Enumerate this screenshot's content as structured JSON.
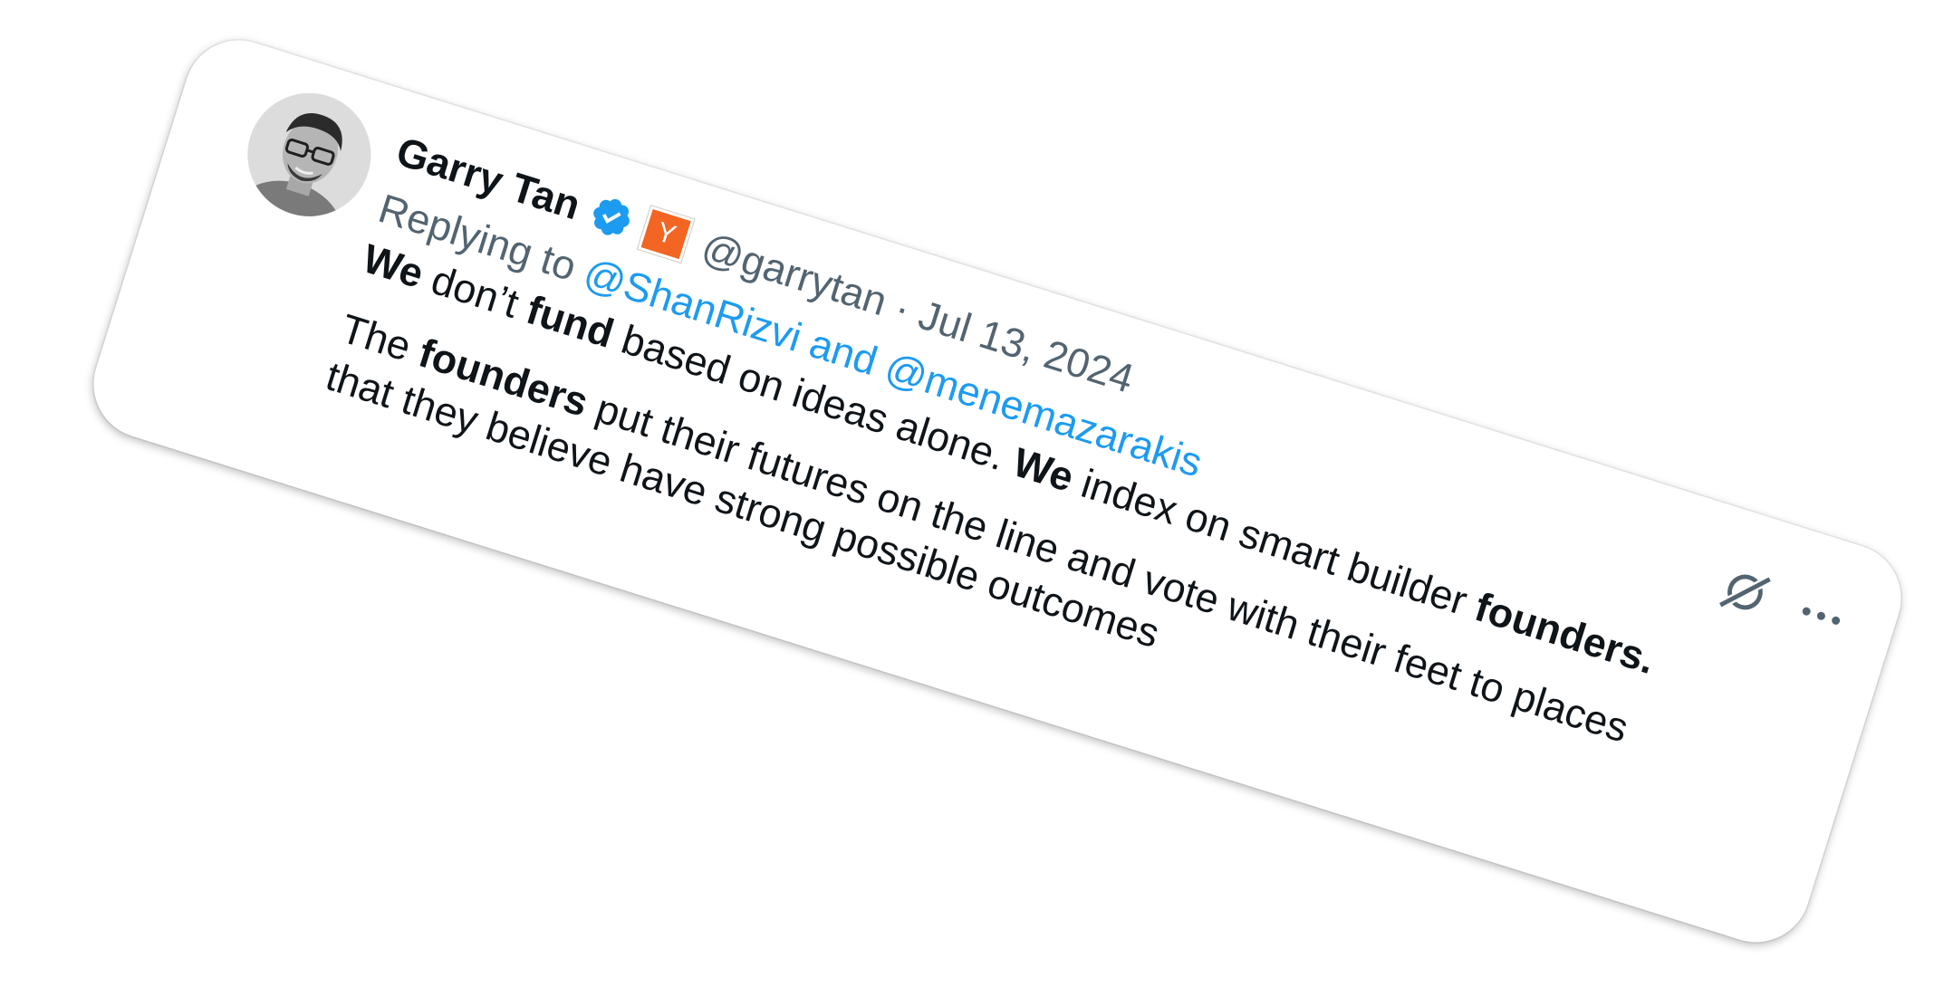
{
  "tweet": {
    "author": {
      "name": "Garry Tan",
      "handle": "@garrytan",
      "verified": true,
      "affiliate_badge": {
        "letter": "Y",
        "color": "#f26522"
      }
    },
    "separator": "·",
    "date": "Jul 13, 2024",
    "reply": {
      "prefix": "Replying to",
      "to": "@ShanRizvi and @menemazarakis"
    },
    "text": {
      "p1": [
        "We",
        " don’t ",
        "fund",
        " based on ideas alone. ",
        "We",
        " index on smart builder ",
        "founders."
      ],
      "p2_line1": [
        "The ",
        "founders",
        " put their futures on the line and vote with their feet to places"
      ],
      "p2_line2": "that they believe have strong possible outcomes"
    },
    "icons": {
      "verified": "verified-badge-icon",
      "grok": "grok-icon",
      "more": "more-options-icon"
    },
    "colors": {
      "text": "#0f1419",
      "secondary": "#536471",
      "link": "#1d9bf0",
      "verified": "#1d9bf0"
    }
  }
}
